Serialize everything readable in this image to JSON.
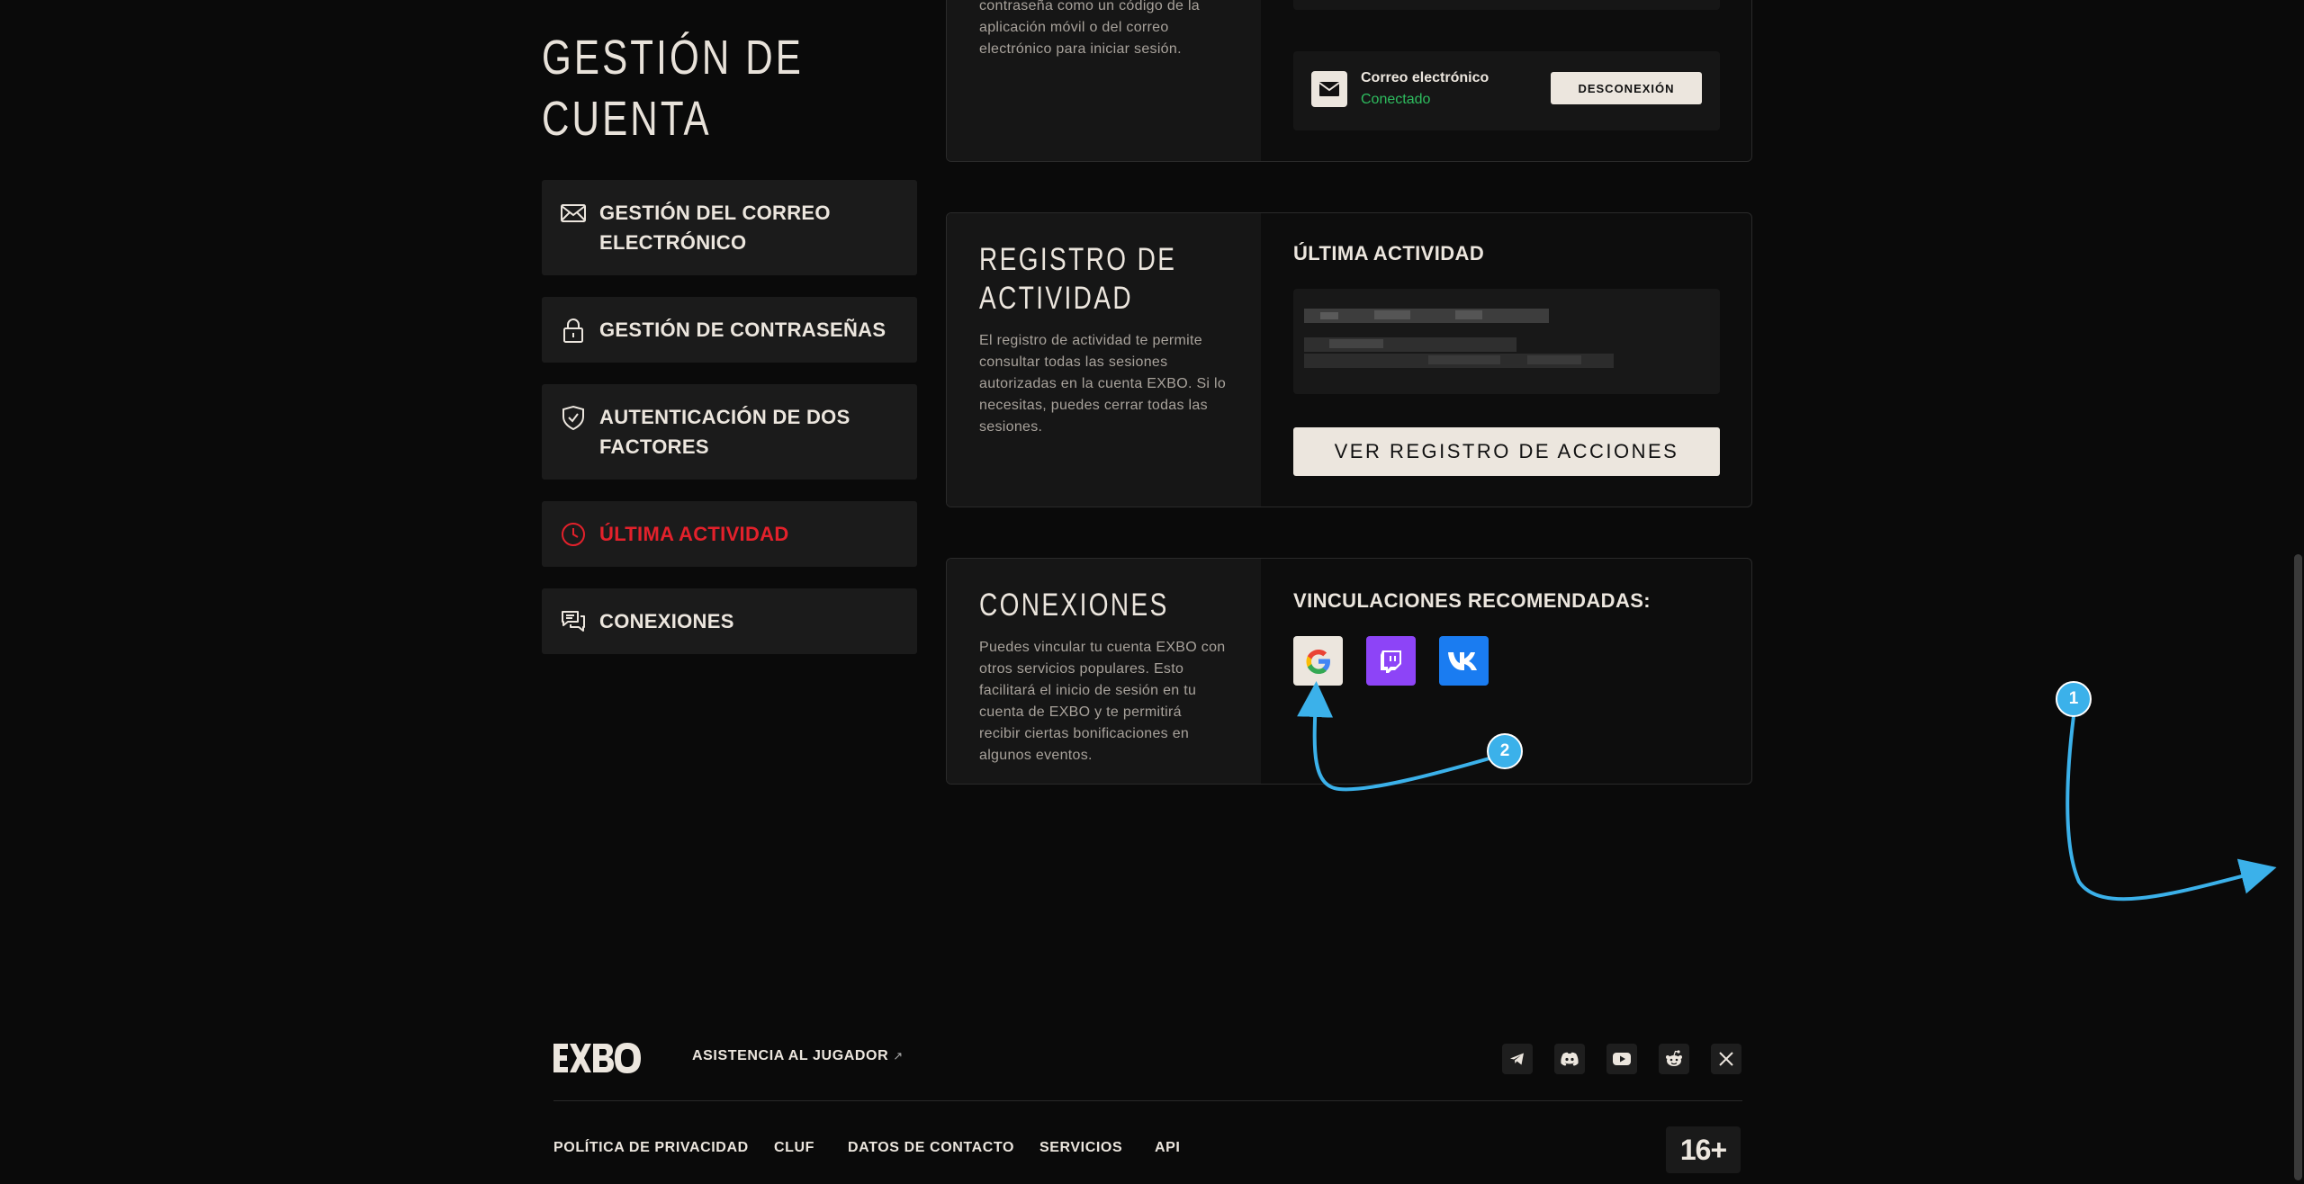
{
  "sidebar": {
    "title": "GESTIÓN DE CUENTA",
    "title_line1": "GESTIÓN DE",
    "title_line2": "CUENTA",
    "items": [
      {
        "label_line1": "GESTIÓN DEL CORREO",
        "label_line2": "ELECTRÓNICO",
        "icon": "envelope-icon"
      },
      {
        "label_line1": "GESTIÓN DE CONTRASEÑAS",
        "icon": "lock-icon"
      },
      {
        "label_line1": "AUTENTICACIÓN DE DOS",
        "label_line2": "FACTORES",
        "icon": "shield-check-icon"
      },
      {
        "label_line1": "ÚLTIMA ACTIVIDAD",
        "icon": "clock-icon",
        "active": true
      },
      {
        "label_line1": "CONEXIONES",
        "icon": "chat-bubbles-icon"
      }
    ]
  },
  "twofa_card": {
    "desc_line1": "contraseña como un código de la",
    "desc_line2": "aplicación móvil o del correo",
    "desc_line3": "electrónico para iniciar sesión.",
    "email_connection": {
      "name": "Correo electrónico",
      "status": "Conectado",
      "button": "DESCONEXIÓN"
    }
  },
  "activity_card": {
    "title_line1": "REGISTRO DE",
    "title_line2": "ACTIVIDAD",
    "desc": [
      "El registro de actividad te permite",
      "consultar todas las sesiones",
      "autorizadas en la cuenta EXBO. Si lo",
      "necesitas, puedes cerrar todas las",
      "sesiones."
    ],
    "section_heading": "ÚLTIMA ACTIVIDAD",
    "button": "VER REGISTRO DE ACCIONES"
  },
  "connections_card": {
    "title": "CONEXIONES",
    "desc": [
      "Puedes vincular tu cuenta EXBO con",
      "otros servicios populares. Esto",
      "facilitará el inicio de sesión en tu",
      "cuenta de EXBO y te permitirá",
      "recibir ciertas bonificaciones en",
      "algunos eventos."
    ],
    "section_heading": "VINCULACIONES RECOMENDADAS:",
    "services": [
      {
        "name": "google",
        "icon": "google-icon",
        "color": "#ece6de"
      },
      {
        "name": "twitch",
        "icon": "twitch-icon",
        "color": "#8d44f7"
      },
      {
        "name": "vk",
        "icon": "vk-icon",
        "color": "#1a7cf1"
      }
    ]
  },
  "annotations": {
    "marker1": "1",
    "marker2": "2",
    "color": "#3bb1ea"
  },
  "footer": {
    "logo": "EXBO",
    "support_link": "ASISTENCIA AL JUGADOR",
    "support_arrow": "↗",
    "links": [
      "POLÍTICA DE PRIVACIDAD",
      "CLUF",
      "DATOS DE CONTACTO",
      "SERVICIOS",
      "API"
    ],
    "socials": [
      "telegram-icon",
      "discord-icon",
      "youtube-icon",
      "reddit-icon",
      "x-icon"
    ],
    "age_rating": "16+"
  },
  "colors": {
    "accent_red": "#e3212b",
    "success_green": "#2ebd5f",
    "background": "#0a0a0a",
    "panel": "#1b1b1b"
  }
}
